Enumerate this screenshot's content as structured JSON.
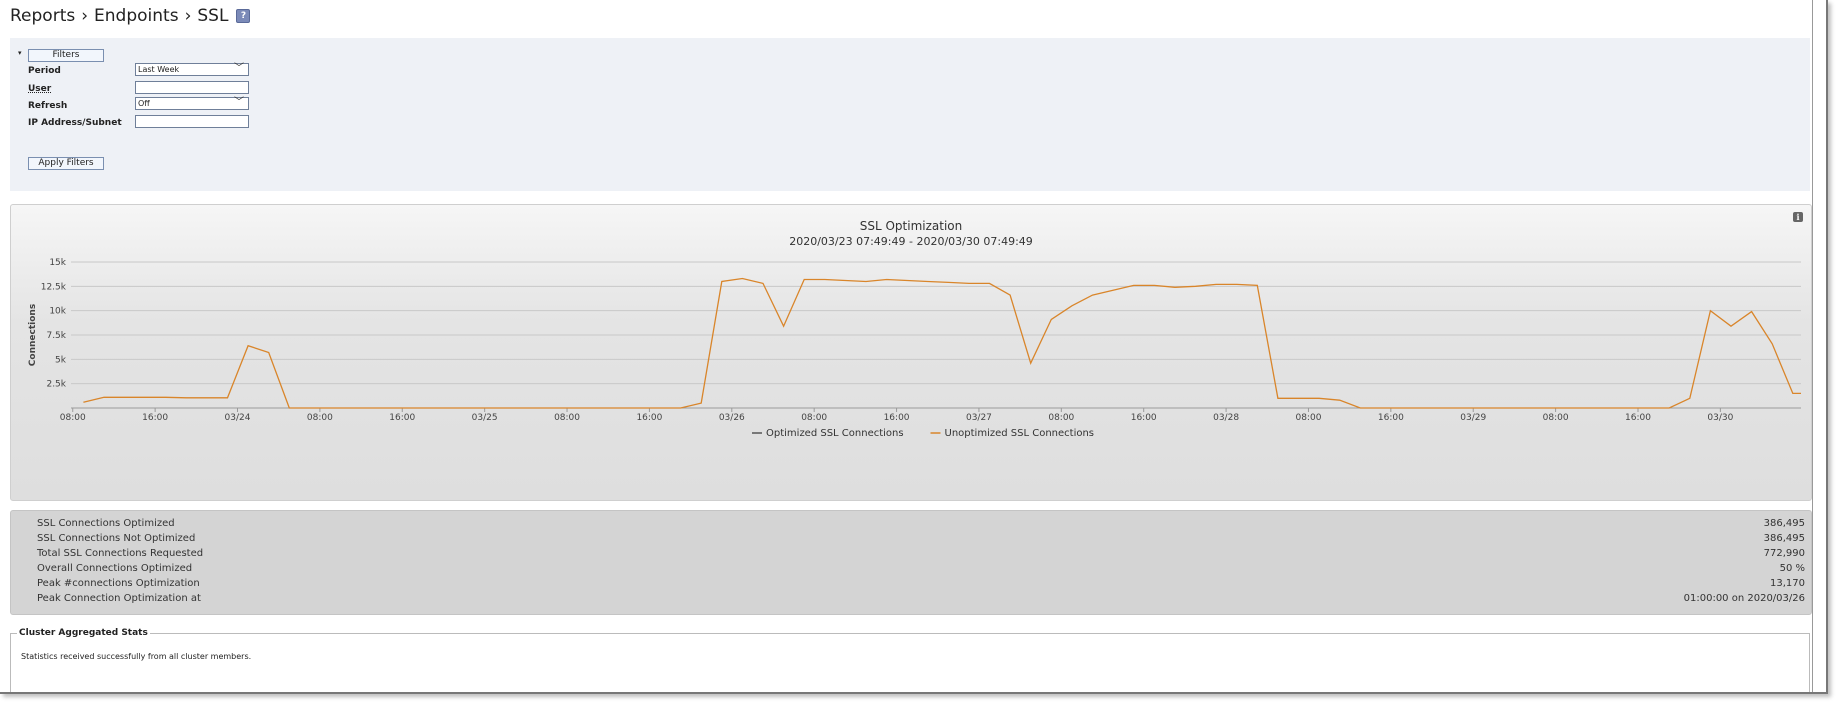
{
  "breadcrumb": {
    "items": [
      "Reports",
      "Endpoints",
      "SSL"
    ],
    "separator": "›",
    "help_icon": "?"
  },
  "filters": {
    "toggle_icon": "▾",
    "filters_button": "Filters",
    "period_label": "Period",
    "period_value": "Last Week",
    "user_label": "User",
    "user_value": "",
    "refresh_label": "Refresh",
    "refresh_value": "Off",
    "ip_label": "IP Address/Subnet",
    "ip_value": "",
    "apply_button": "Apply Filters"
  },
  "chart_info_icon": "i",
  "chart_data": {
    "type": "line",
    "title": "SSL Optimization",
    "subtitle": "2020/03/23 07:49:49 - 2020/03/30 07:49:49",
    "ylabel": "Connections",
    "xlabel": "",
    "ylim": [
      0,
      15000
    ],
    "y_ticks": [
      2500,
      5000,
      7500,
      10000,
      12500,
      15000
    ],
    "y_tick_labels": [
      "2.5k",
      "5k",
      "7.5k",
      "10k",
      "12.5k",
      "15k"
    ],
    "x_range_hours": [
      0,
      168
    ],
    "x_ticks": [
      {
        "h": 0.17,
        "label": "08:00"
      },
      {
        "h": 8.17,
        "label": "16:00"
      },
      {
        "h": 16.17,
        "label": "03/24"
      },
      {
        "h": 24.17,
        "label": "08:00"
      },
      {
        "h": 32.17,
        "label": "16:00"
      },
      {
        "h": 40.17,
        "label": "03/25"
      },
      {
        "h": 48.17,
        "label": "08:00"
      },
      {
        "h": 56.17,
        "label": "16:00"
      },
      {
        "h": 64.17,
        "label": "03/26"
      },
      {
        "h": 72.17,
        "label": "08:00"
      },
      {
        "h": 80.17,
        "label": "16:00"
      },
      {
        "h": 88.17,
        "label": "03/27"
      },
      {
        "h": 96.17,
        "label": "08:00"
      },
      {
        "h": 104.17,
        "label": "16:00"
      },
      {
        "h": 112.17,
        "label": "03/28"
      },
      {
        "h": 120.17,
        "label": "08:00"
      },
      {
        "h": 128.17,
        "label": "16:00"
      },
      {
        "h": 136.17,
        "label": "03/29"
      },
      {
        "h": 144.17,
        "label": "08:00"
      },
      {
        "h": 152.17,
        "label": "16:00"
      },
      {
        "h": 160.17,
        "label": "03/30"
      }
    ],
    "grid": true,
    "legend_position": "bottom-center",
    "series": [
      {
        "name": "Optimized SSL Connections",
        "color": "#555555",
        "points": []
      },
      {
        "name": "Unoptimized SSL Connections",
        "color": "#d9852a",
        "points": [
          [
            1.2,
            600
          ],
          [
            3.2,
            1100
          ],
          [
            5.2,
            1100
          ],
          [
            7.2,
            1100
          ],
          [
            9.2,
            1100
          ],
          [
            11.2,
            1050
          ],
          [
            13.2,
            1050
          ],
          [
            15.2,
            1050
          ],
          [
            17.2,
            6400
          ],
          [
            19.2,
            5700
          ],
          [
            21.2,
            0
          ],
          [
            23.2,
            0
          ],
          [
            27.2,
            0
          ],
          [
            39.2,
            0
          ],
          [
            51.2,
            0
          ],
          [
            59.2,
            0
          ],
          [
            61.2,
            500
          ],
          [
            63.2,
            13000
          ],
          [
            65.2,
            13300
          ],
          [
            67.2,
            12800
          ],
          [
            69.2,
            8400
          ],
          [
            71.2,
            13200
          ],
          [
            73.2,
            13200
          ],
          [
            75.2,
            13100
          ],
          [
            77.2,
            13000
          ],
          [
            79.2,
            13200
          ],
          [
            81.2,
            13100
          ],
          [
            83.2,
            13000
          ],
          [
            85.2,
            12900
          ],
          [
            87.2,
            12800
          ],
          [
            89.2,
            12800
          ],
          [
            91.2,
            11600
          ],
          [
            93.2,
            4600
          ],
          [
            95.2,
            9100
          ],
          [
            97.2,
            10500
          ],
          [
            99.2,
            11600
          ],
          [
            101.2,
            12100
          ],
          [
            103.2,
            12600
          ],
          [
            105.2,
            12600
          ],
          [
            107.2,
            12400
          ],
          [
            109.2,
            12500
          ],
          [
            111.2,
            12700
          ],
          [
            113.2,
            12700
          ],
          [
            115.2,
            12600
          ],
          [
            117.2,
            1000
          ],
          [
            119.2,
            1000
          ],
          [
            121.2,
            1000
          ],
          [
            123.2,
            800
          ],
          [
            125.2,
            0
          ],
          [
            127.2,
            0
          ],
          [
            139.2,
            0
          ],
          [
            151.2,
            0
          ],
          [
            155.2,
            0
          ],
          [
            157.2,
            1000
          ],
          [
            159.2,
            10000
          ],
          [
            161.2,
            8400
          ],
          [
            163.2,
            9900
          ],
          [
            165.2,
            6600
          ],
          [
            167.2,
            1500
          ],
          [
            168,
            1500
          ]
        ]
      }
    ]
  },
  "stats": [
    {
      "label": "SSL Connections Optimized",
      "value": "386,495"
    },
    {
      "label": "SSL Connections Not Optimized",
      "value": "386,495"
    },
    {
      "label": "Total SSL Connections Requested",
      "value": "772,990"
    },
    {
      "label": "Overall Connections Optimized",
      "value": "50 %"
    },
    {
      "label": "Peak #connections Optimization",
      "value": "13,170"
    },
    {
      "label": "Peak Connection Optimization at",
      "value": "01:00:00 on 2020/03/26"
    }
  ],
  "cluster": {
    "title": "Cluster Aggregated Stats",
    "message": "Statistics received successfully from all cluster members."
  }
}
